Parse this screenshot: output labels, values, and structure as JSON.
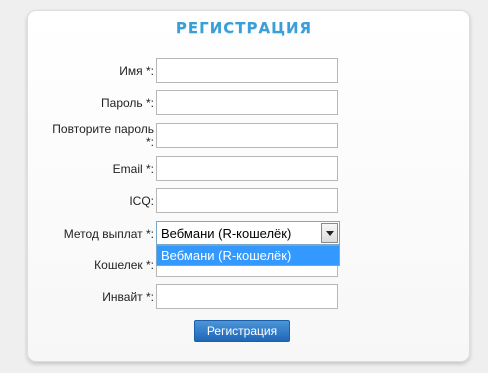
{
  "form": {
    "title": "РЕГИСТРАЦИЯ",
    "labels": {
      "name": "Имя *:",
      "password": "Пароль *:",
      "password_repeat": "Повторите пароль *:",
      "email": "Email *:",
      "icq": "ICQ:",
      "payout_method": "Метод выплат *:",
      "wallet": "Кошелек *:",
      "invite": "Инвайт *:"
    },
    "values": {
      "name": "",
      "password": "",
      "password_repeat": "",
      "email": "",
      "icq": "",
      "wallet": "",
      "invite": ""
    },
    "payout_method": {
      "selected": "Вебмани (R-кошелёк)",
      "options": [
        "Вебмани (R-кошелёк)"
      ]
    },
    "submit_label": "Регистрация"
  },
  "colors": {
    "title": "#3a9fd9",
    "highlight": "#3399ff",
    "button": "#2b78c8"
  },
  "icons": {
    "dropdown_arrow": "chevron-down-icon"
  }
}
